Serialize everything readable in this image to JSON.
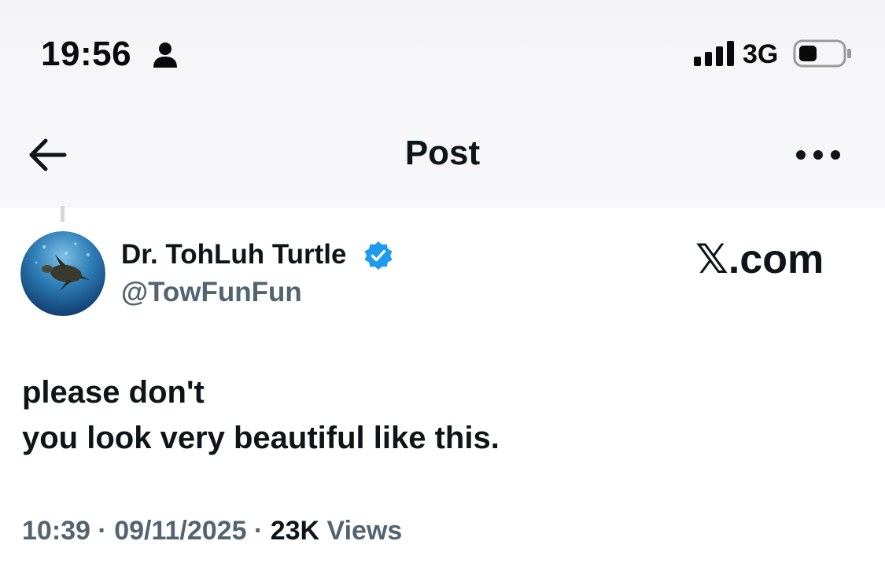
{
  "status_bar": {
    "time": "19:56",
    "network": "3G",
    "icons": [
      "person-icon",
      "signal-icon",
      "battery-icon"
    ]
  },
  "header": {
    "title": "Post",
    "back_icon": "arrow-left-icon",
    "more_icon": "more-horizontal-icon"
  },
  "author": {
    "name": "Dr. TohLuh Turtle",
    "handle": "@TowFunFun",
    "verified": true,
    "avatar_icon": "sea-turtle-avatar"
  },
  "brand_text": "𝕏.com",
  "post": {
    "lines": [
      "please don't",
      "you look very beautiful like this."
    ]
  },
  "meta": {
    "time": "10:39",
    "separator": " · ",
    "date": "09/11/2025",
    "views_count": "23K",
    "views_label": " Views"
  },
  "colors": {
    "text_primary": "#0f1419",
    "text_secondary": "#536471",
    "verified_blue": "#1d9bf0",
    "header_bg": "#f7f7f9"
  }
}
